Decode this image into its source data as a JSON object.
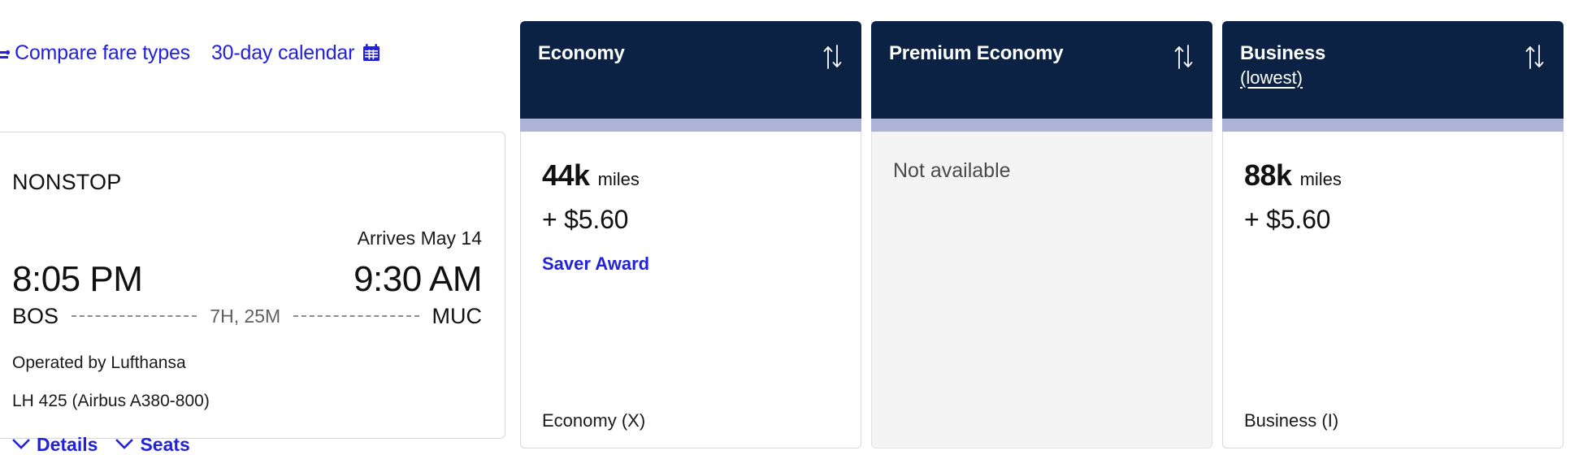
{
  "toolbar": {
    "compare_icon": "compare-seat-icon",
    "compare_label": "Compare fare types",
    "calendar_label": "30-day calendar",
    "calendar_icon": "calendar-icon"
  },
  "flight": {
    "stops": "NONSTOP",
    "arrives_note": "Arrives May 14",
    "depart_time": "8:05 PM",
    "arrive_time": "9:30 AM",
    "origin": "BOS",
    "destination": "MUC",
    "duration": "7H, 25M",
    "operated_by": "Operated by Lufthansa",
    "flight_number": "LH 425 (Airbus A380-800)",
    "details_label": "Details",
    "seats_label": "Seats",
    "details_icon": "chevron-down-icon",
    "seats_icon": "chevron-down-icon"
  },
  "fares": [
    {
      "cabin": "Economy",
      "subtitle": "",
      "sort_icon": "sort-updown-icon",
      "available": true,
      "miles": "44k",
      "miles_unit": "miles",
      "cash": "+ $5.60",
      "award_type": "Saver Award",
      "fare_class": "Economy (X)",
      "unavailable_text": ""
    },
    {
      "cabin": "Premium Economy",
      "subtitle": "",
      "sort_icon": "sort-updown-icon",
      "available": false,
      "miles": "",
      "miles_unit": "",
      "cash": "",
      "award_type": "",
      "fare_class": "",
      "unavailable_text": "Not available"
    },
    {
      "cabin": "Business",
      "subtitle": "(lowest)",
      "sort_icon": "sort-updown-icon",
      "available": true,
      "miles": "88k",
      "miles_unit": "miles",
      "cash": "+ $5.60",
      "award_type": "",
      "fare_class": "Business (I)",
      "unavailable_text": ""
    }
  ],
  "colors": {
    "header_navy": "#0b2244",
    "accent_lavender": "#adb3d6",
    "link_blue": "#2222dd",
    "unavailable_bg": "#f4f4f4"
  }
}
